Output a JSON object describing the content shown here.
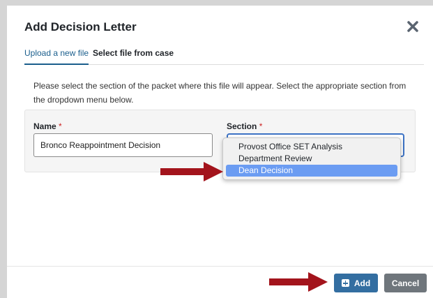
{
  "modal": {
    "title": "Add Decision Letter",
    "close_icon": "close-icon"
  },
  "tabs": [
    {
      "label": "Upload a new file",
      "active": true
    },
    {
      "label": "Select file from case",
      "active": false
    }
  ],
  "instructions": "Please select the section of the packet where this file will appear. Select the appropriate section from the dropdown menu below.",
  "form": {
    "name_label": "Name",
    "name_required_marker": "*",
    "name_value": "Bronco Reappointment Decision",
    "section_label": "Section",
    "section_required_marker": "*"
  },
  "dropdown": {
    "options": [
      "Provost Office SET Analysis",
      "Department Review",
      "Dean Decision"
    ],
    "highlighted": "Dean Decision"
  },
  "footer": {
    "add_label": "Add",
    "cancel_label": "Cancel"
  },
  "colors": {
    "accent": "#1a5e8c",
    "add_button": "#336ea1",
    "cancel_button": "#6f767c",
    "highlight": "#6b9cf2",
    "annotation_arrow": "#a3141c",
    "required": "#cc2222"
  }
}
